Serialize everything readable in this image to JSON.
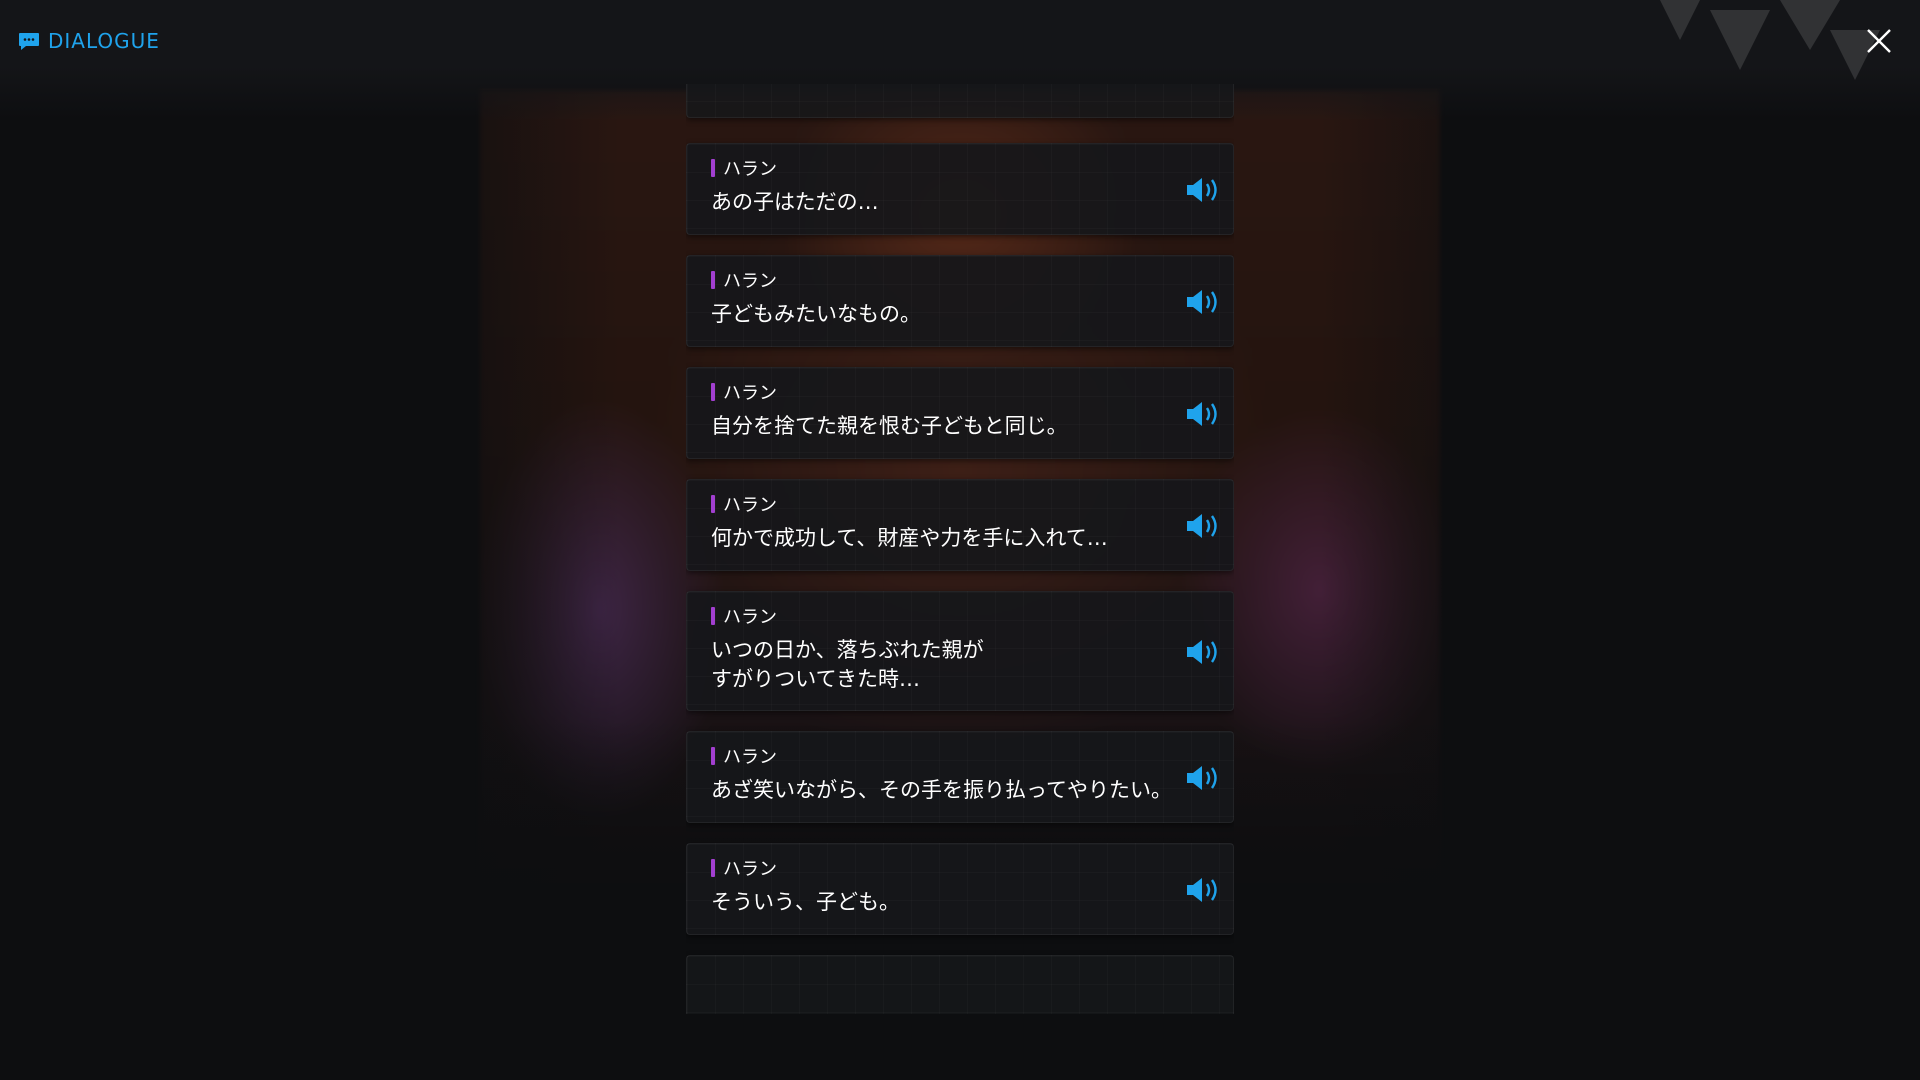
{
  "header": {
    "title": "DIALOGUE",
    "title_icon": "chat-bubble-icon",
    "close_icon": "close-icon",
    "accent_color": "#1fa3ec"
  },
  "dialogue": {
    "speaker_color": "#a23fd0",
    "voice_icon": "speaker-volume-icon",
    "lines": [
      {
        "speaker": "ハラン",
        "text": "あの子はただの…"
      },
      {
        "speaker": "ハラン",
        "text": "子どもみたいなもの。"
      },
      {
        "speaker": "ハラン",
        "text": "自分を捨てた親を恨む子どもと同じ。"
      },
      {
        "speaker": "ハラン",
        "text": "何かで成功して、財産や力を手に入れて…"
      },
      {
        "speaker": "ハラン",
        "text": "いつの日か、落ちぶれた親が\nすがりついてきた時…"
      },
      {
        "speaker": "ハラン",
        "text": "あざ笑いながら、その手を振り払ってやりたい。"
      },
      {
        "speaker": "ハラン",
        "text": "そういう、子ども。"
      }
    ]
  }
}
